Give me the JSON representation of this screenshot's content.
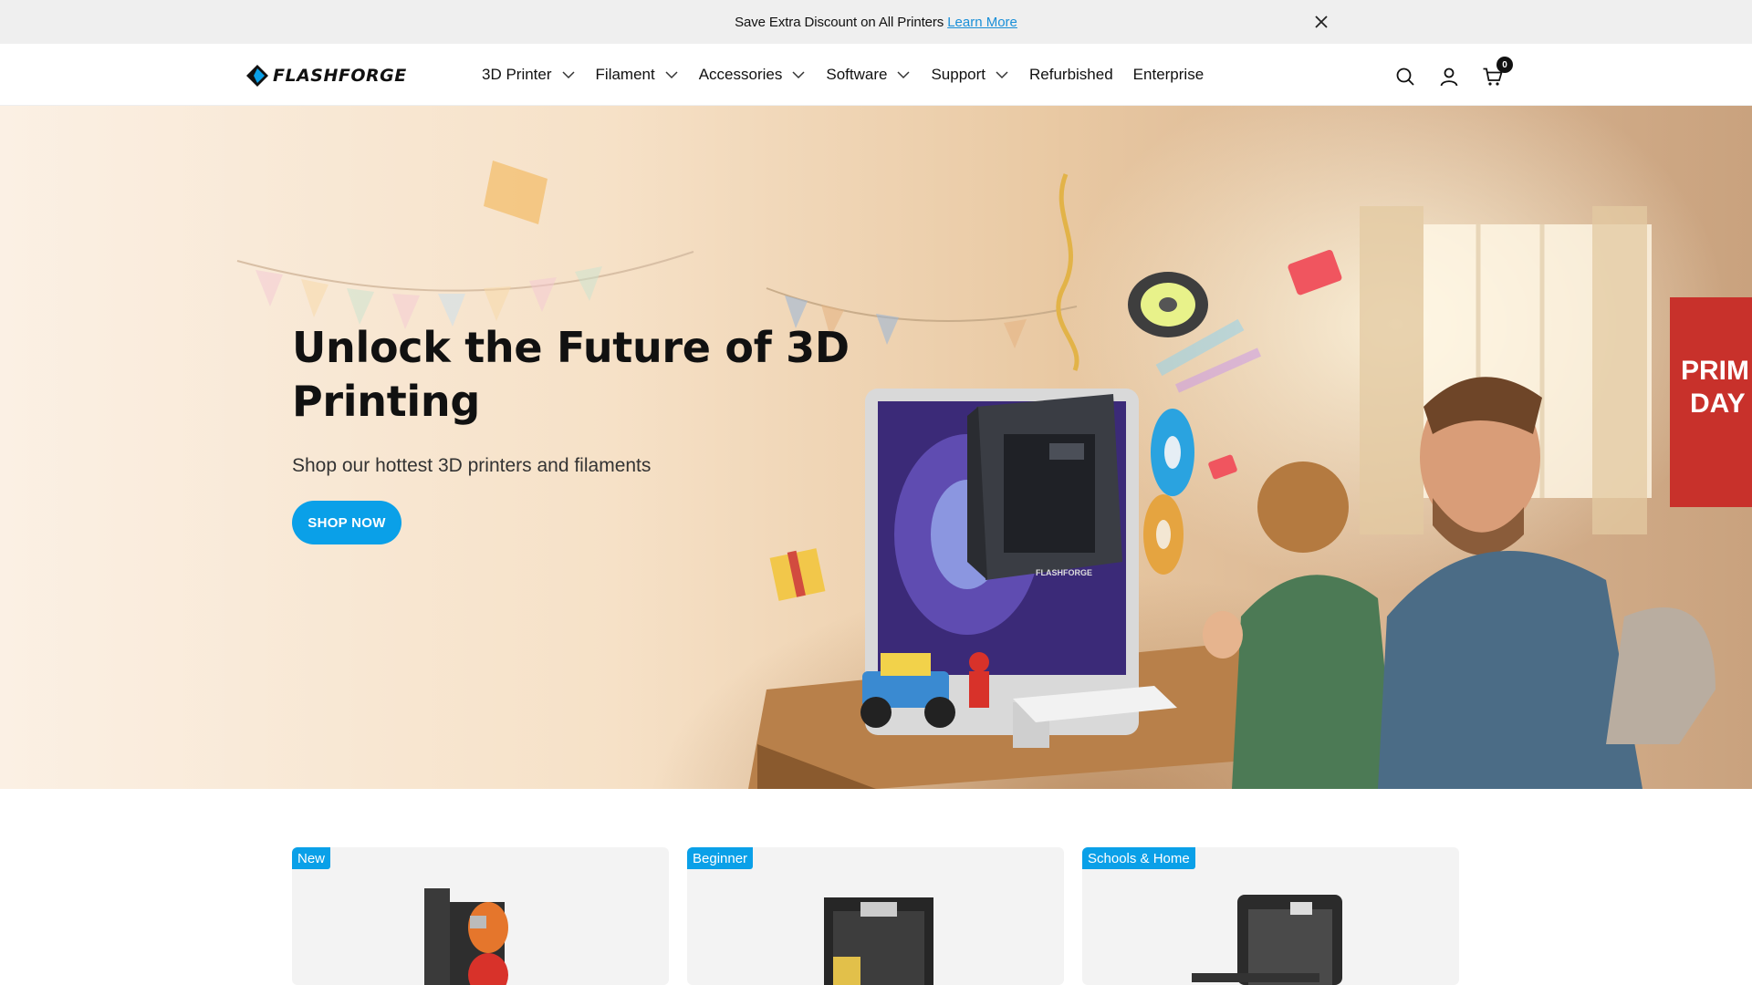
{
  "announcement": {
    "text": "Save Extra Discount on All Printers",
    "link": "Learn More"
  },
  "header": {
    "logo_text": "FLASHFORGE",
    "nav": [
      {
        "label": "3D Printer",
        "dropdown": true
      },
      {
        "label": "Filament",
        "dropdown": true
      },
      {
        "label": "Accessories",
        "dropdown": true
      },
      {
        "label": "Software",
        "dropdown": true
      },
      {
        "label": "Support",
        "dropdown": true
      },
      {
        "label": "Refurbished",
        "dropdown": false
      },
      {
        "label": "Enterprise",
        "dropdown": false
      }
    ],
    "icons": [
      "search-icon",
      "account-icon",
      "cart-icon"
    ],
    "cart_count": "0"
  },
  "hero": {
    "title": "Unlock the Future of 3D Printing",
    "subtitle": "Shop our hottest 3D printers and filaments",
    "cta": "SHOP NOW",
    "printer_label": "FLASHFORGE",
    "poster_text": "PRIM DAY"
  },
  "products": [
    {
      "badge": "New"
    },
    {
      "badge": "Beginner"
    },
    {
      "badge": "Schools & Home"
    }
  ],
  "colors": {
    "accent": "#0aa0e8",
    "announcement_bg": "#efefef",
    "text": "#111111",
    "card_bg": "#f3f3f3"
  }
}
